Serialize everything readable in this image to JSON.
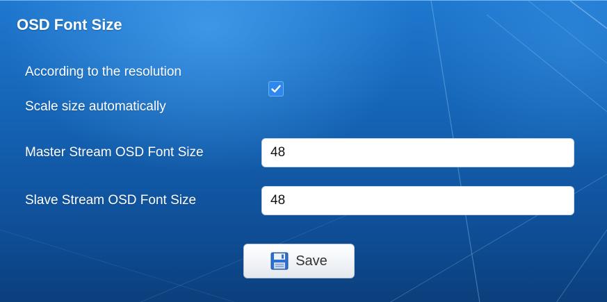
{
  "panel": {
    "title": "OSD Font Size"
  },
  "auto_scale": {
    "label_line1": "According to the resolution",
    "label_line2": "Scale size automatically",
    "checked": true
  },
  "master_stream": {
    "label": "Master Stream OSD Font Size",
    "value": "48"
  },
  "slave_stream": {
    "label": "Slave Stream OSD Font Size",
    "value": "48"
  },
  "actions": {
    "save_label": "Save",
    "save_icon": "floppy-disk-icon"
  },
  "colors": {
    "background": "#1565b7",
    "checkbox": "#2d87ef",
    "text": "#ffffff"
  }
}
